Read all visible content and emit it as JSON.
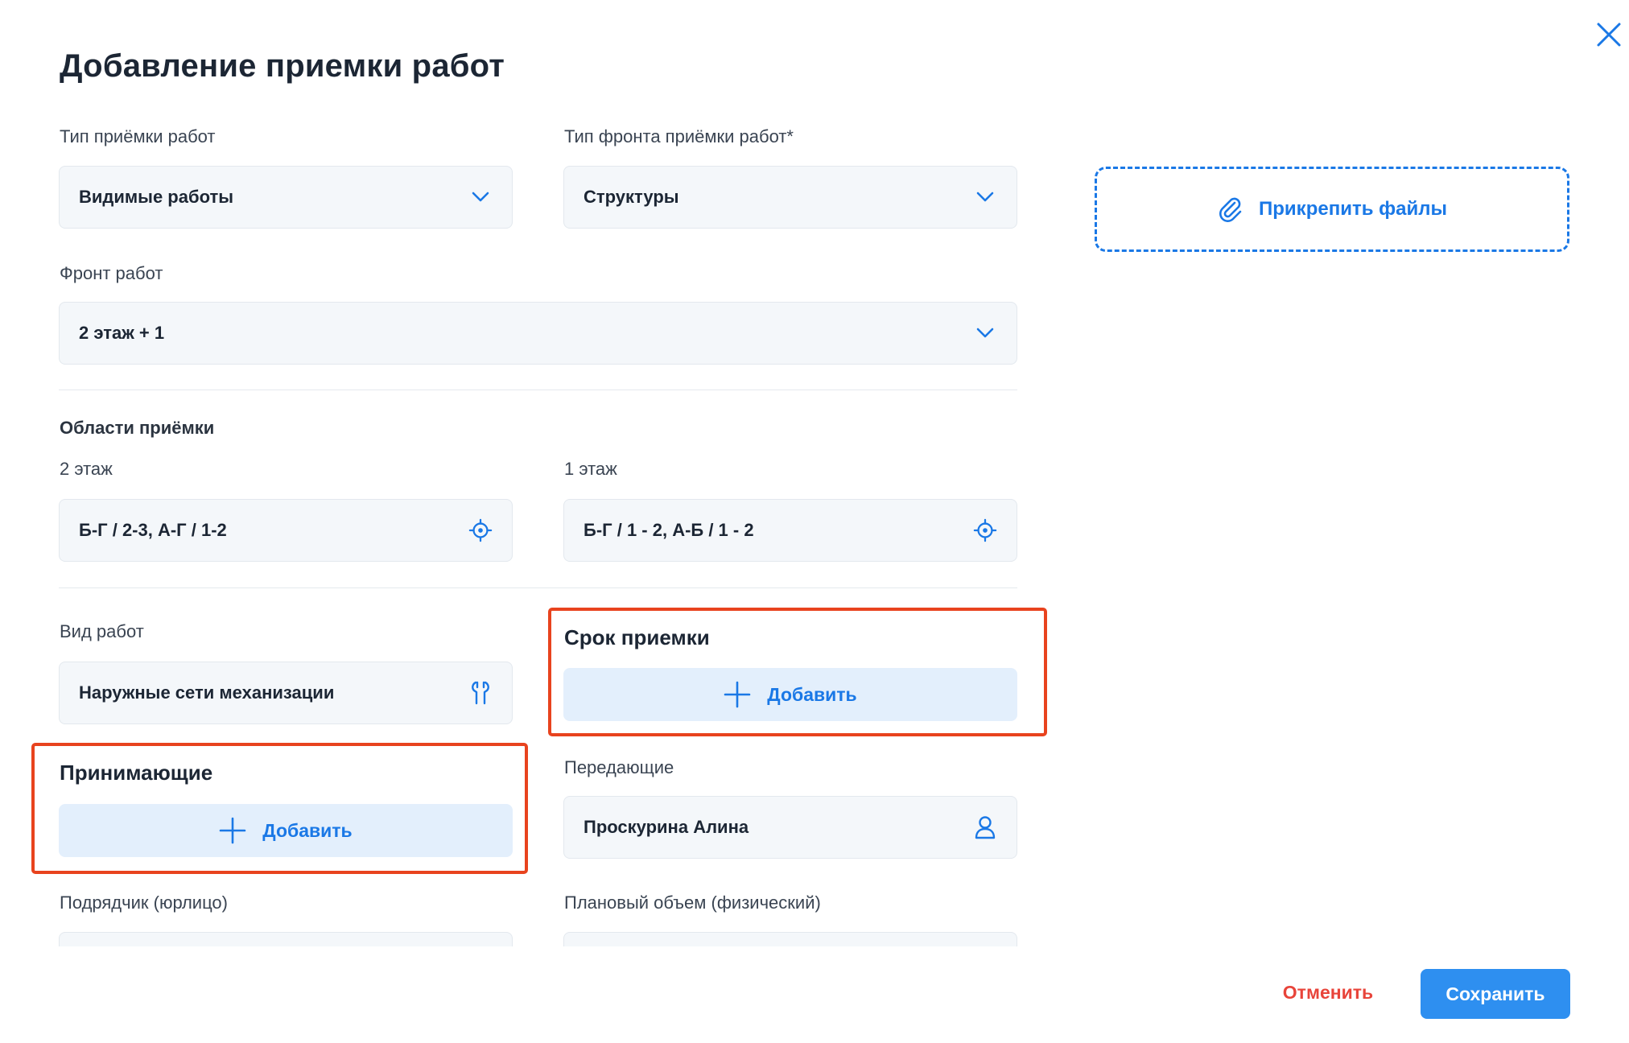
{
  "dialog": {
    "title": "Добавление приемки работ"
  },
  "acceptance_type": {
    "label": "Тип приёмки работ",
    "value": "Видимые работы"
  },
  "front_type": {
    "label": "Тип фронта приёмки работ*",
    "value": "Структуры"
  },
  "work_front": {
    "label": "Фронт работ",
    "value": "2 этаж + 1"
  },
  "areas": {
    "section_title": "Области приёмки",
    "items": [
      {
        "label": "2 этаж",
        "value": "Б-Г / 2-3, А-Г / 1-2"
      },
      {
        "label": "1 этаж",
        "value": "Б-Г / 1 - 2, А-Б / 1 - 2"
      }
    ]
  },
  "work_kind": {
    "label": "Вид работ",
    "value": "Наружные сети механизации"
  },
  "deadline": {
    "title": "Срок приемки",
    "add_label": "Добавить"
  },
  "receivers": {
    "title": "Принимающие",
    "add_label": "Добавить"
  },
  "transferors": {
    "label": "Передающие",
    "value": "Проскурина Алина"
  },
  "contractor": {
    "label": "Подрядчик (юрлицо)",
    "value": ""
  },
  "planned_volume": {
    "label": "Плановый объем (физический)",
    "value": ""
  },
  "attach": {
    "label": "Прикрепить файлы"
  },
  "footer": {
    "cancel_label": "Отменить",
    "save_label": "Сохранить"
  },
  "icons": {
    "close": "close-icon",
    "dropdown": "chevron-down-icon",
    "target": "target-icon",
    "wrench": "wrench-icon",
    "person": "person-icon",
    "plus": "plus-icon",
    "paperclip": "paperclip-icon"
  },
  "colors": {
    "accent": "#1a78e6",
    "primary_button": "#2e8ff0",
    "danger": "#e8443a",
    "highlight": "#e8431e",
    "field_bg": "#f4f7fa",
    "add_bg": "#e3effc"
  }
}
